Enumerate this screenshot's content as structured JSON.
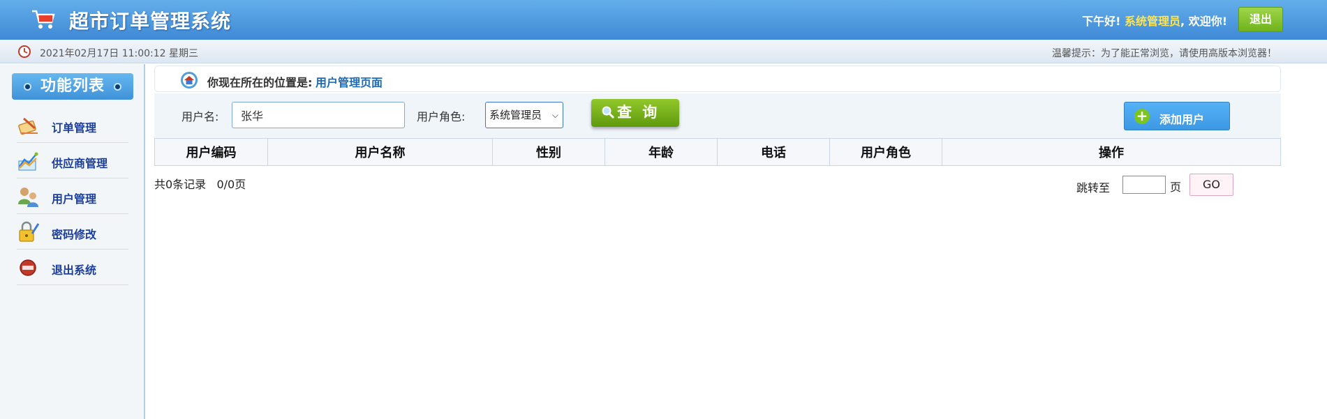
{
  "header": {
    "title": "超市订单管理系统",
    "greeting_prefix": "下午好!",
    "user_role_name": "系统管理员",
    "greeting_suffix": ", 欢迎你!",
    "logout_label": "退出",
    "cart_icon": "shopping-cart-icon"
  },
  "infobar": {
    "datetime": "2021年02月17日 11:00:12 星期三",
    "tip": "温馨提示：为了能正常浏览，请使用高版本浏览器！",
    "clock_icon": "clock-icon"
  },
  "sidebar": {
    "title": "功能列表",
    "items": [
      {
        "label": "订单管理",
        "icon": "order-icon"
      },
      {
        "label": "供应商管理",
        "icon": "supplier-icon"
      },
      {
        "label": "用户管理",
        "icon": "users-icon"
      },
      {
        "label": "密码修改",
        "icon": "lock-icon"
      },
      {
        "label": "退出系统",
        "icon": "exit-icon"
      }
    ]
  },
  "location": {
    "label": "你现在所在的位置是:",
    "value": "用户管理页面",
    "icon": "home-icon"
  },
  "search": {
    "username_label": "用户名:",
    "username_value": "张华",
    "role_label": "用户角色:",
    "role_selected": "系统管理员",
    "query_label": "查 询",
    "add_label": "添加用户"
  },
  "table": {
    "columns": [
      "用户编码",
      "用户名称",
      "性别",
      "年龄",
      "电话",
      "用户角色",
      "操作"
    ]
  },
  "pagination": {
    "record_count": "共0条记录",
    "page_info": "0/0页",
    "jump_label": "跳转至",
    "page_unit": "页",
    "go_label": "GO",
    "page_input_value": ""
  },
  "colors": {
    "header_blue": "#3f89d6",
    "accent_green": "#6fb21b",
    "highlight_yellow": "#ffe44d",
    "link_blue": "#1c6bb8"
  }
}
